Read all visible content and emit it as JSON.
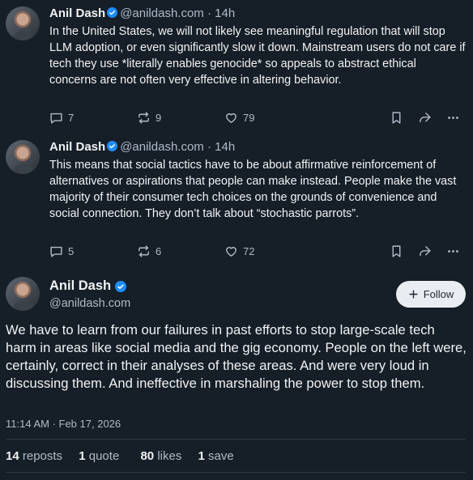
{
  "colors": {
    "background": "#161e27",
    "verified": "#208bfe",
    "muted": "#aebbc9",
    "text": "#f1f3f5"
  },
  "posts": [
    {
      "name": "Anil Dash",
      "handle": "@anildash.com",
      "meta_sep": " · ",
      "time": "14h",
      "text": "In the United States, we will not likely see meaningful regulation that will stop LLM adoption, or even significantly slow it down. Mainstream users do not care if tech they use *literally enables genocide* so appeals to abstract ethical concerns are not often very effective in altering behavior.",
      "replies": "7",
      "reposts": "9",
      "likes": "79"
    },
    {
      "name": "Anil Dash",
      "handle": "@anildash.com",
      "meta_sep": " · ",
      "time": "14h",
      "text": "This means that social tactics have to be about affirmative reinforcement of alternatives or aspirations that people can make instead. People make the vast majority of their consumer tech choices on the grounds of convenience and social connection. They don’t talk about “stochastic parrots”.",
      "replies": "5",
      "reposts": "6",
      "likes": "72"
    }
  ],
  "main_post": {
    "name": "Anil Dash",
    "handle": "@anildash.com",
    "follow_label": "Follow",
    "text": "We have to learn from our failures in past efforts to stop large-scale tech harm in areas like social media and the gig economy. People on the left were, certainly, correct in their analyses of these areas. And were very loud in discussing them. And ineffective in marshaling the power to stop them.",
    "timestamp": "11:14 AM · Feb 17, 2026",
    "stats": {
      "reposts_count": "14",
      "reposts_label": "reposts",
      "quotes_count": "1",
      "quotes_label": "quote",
      "likes_count": "80",
      "likes_label": "likes",
      "saves_count": "1",
      "saves_label": "save"
    }
  },
  "icons": [
    "verified-check-icon",
    "reply-icon",
    "repost-icon",
    "heart-icon",
    "bookmark-icon",
    "share-icon",
    "more-icon",
    "plus-icon"
  ]
}
